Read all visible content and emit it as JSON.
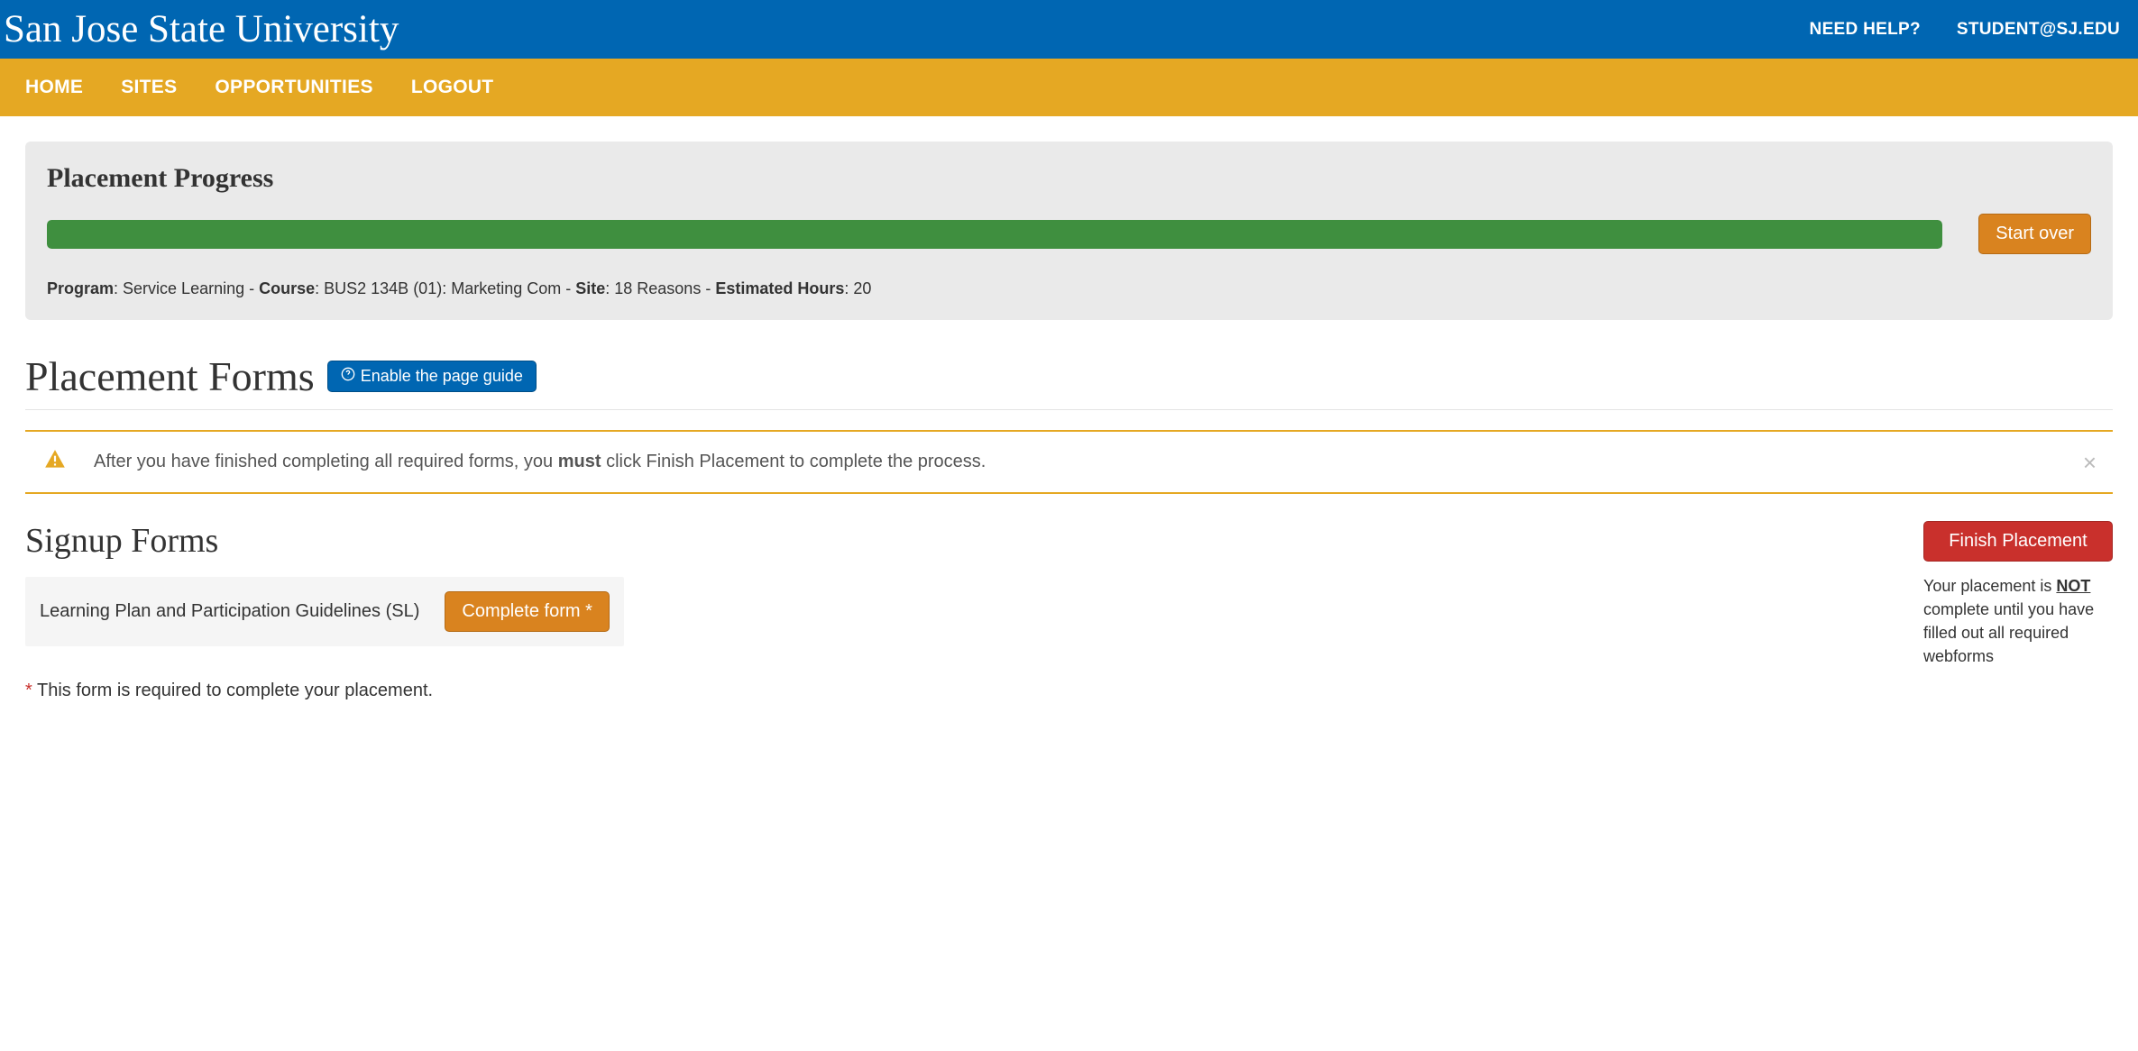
{
  "header": {
    "brand": "San Jose State University",
    "help_link": "NEED HELP?",
    "user_link": "STUDENT@SJ.EDU"
  },
  "nav": {
    "items": [
      "HOME",
      "SITES",
      "OPPORTUNITIES",
      "LOGOUT"
    ]
  },
  "progress": {
    "title": "Placement Progress",
    "start_over_label": "Start over",
    "meta": {
      "program_label": "Program",
      "program_value": ": Service Learning - ",
      "course_label": "Course",
      "course_value": ": BUS2 134B (01): Marketing Com - ",
      "site_label": "Site",
      "site_value": ": 18 Reasons - ",
      "hours_label": "Estimated Hours",
      "hours_value": ": 20"
    }
  },
  "page_title": "Placement Forms",
  "guide_button": "Enable the page guide",
  "alert": {
    "text_before": "After you have finished completing all required forms, you ",
    "text_bold": "must",
    "text_after": " click Finish Placement to complete the process."
  },
  "signup": {
    "title": "Signup Forms",
    "form_name": "Learning Plan and Participation Guidelines (SL)",
    "complete_label": "Complete form *",
    "footnote_star": "*",
    "footnote_text": " This form is required to complete your placement."
  },
  "finish": {
    "button_label": "Finish Placement",
    "note_before": "Your placement is ",
    "note_not": "NOT",
    "note_after": " complete until you have filled out all required webforms"
  }
}
